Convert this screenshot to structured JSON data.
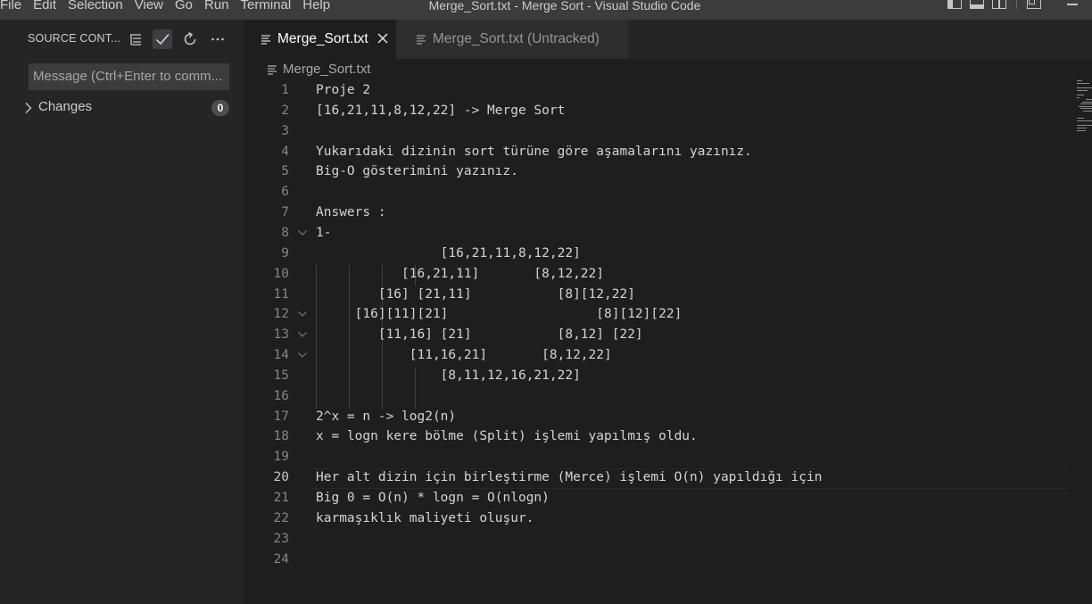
{
  "menu": [
    "File",
    "Edit",
    "Selection",
    "View",
    "Go",
    "Run",
    "Terminal",
    "Help"
  ],
  "window_title": "Merge_Sort.txt - Merge Sort - Visual Studio Code",
  "sidebar": {
    "title": "SOURCE CONT...",
    "commit_placeholder": "Message (Ctrl+Enter to comm...",
    "changes": {
      "label": "Changes",
      "count": "0"
    }
  },
  "tabs": [
    {
      "label": "Merge_Sort.txt",
      "active": true
    },
    {
      "label": "Merge_Sort.txt (Untracked)",
      "active": false
    }
  ],
  "breadcrumb": "Merge_Sort.txt",
  "current_line": 20,
  "lines": [
    {
      "n": "1",
      "text": "Proje 2"
    },
    {
      "n": "2",
      "text": "[16,21,11,8,12,22] -> Merge Sort"
    },
    {
      "n": "3",
      "text": ""
    },
    {
      "n": "4",
      "text": "Yukarıdaki dizinin sort türüne göre aşamalarını yazınız."
    },
    {
      "n": "5",
      "text": "Big-O gösterimini yazınız."
    },
    {
      "n": "6",
      "text": ""
    },
    {
      "n": "7",
      "text": "Answers :"
    },
    {
      "n": "8",
      "text": "1-"
    },
    {
      "n": "9",
      "text": "                [16,21,11,8,12,22]"
    },
    {
      "n": "10",
      "text": "           [16,21,11]       [8,12,22]"
    },
    {
      "n": "11",
      "text": "        [16] [21,11]           [8][12,22]"
    },
    {
      "n": "12",
      "text": "     [16][11][21]                   [8][12][22]"
    },
    {
      "n": "13",
      "text": "        [11,16] [21]           [8,12] [22]"
    },
    {
      "n": "14",
      "text": "            [11,16,21]       [8,12,22]"
    },
    {
      "n": "15",
      "text": "                [8,11,12,16,21,22]"
    },
    {
      "n": "16",
      "text": ""
    },
    {
      "n": "17",
      "text": "2^x = n -> log2(n)"
    },
    {
      "n": "18",
      "text": "x = logn kere bölme (Split) işlemi yapılmış oldu."
    },
    {
      "n": "19",
      "text": ""
    },
    {
      "n": "20",
      "text": "Her alt dizin için birleştirme (Merce) işlemi O(n) yapıldığı için"
    },
    {
      "n": "21",
      "text": "Big 0 = O(n) * logn = O(nlogn)"
    },
    {
      "n": "22",
      "text": "karmaşıklık maliyeti oluşur."
    },
    {
      "n": "23",
      "text": ""
    },
    {
      "n": "24",
      "text": ""
    }
  ],
  "folds": [
    "8",
    "12",
    "13",
    "14"
  ],
  "icons": {
    "tree_view": "list-tree-icon",
    "commit": "check-icon",
    "refresh": "refresh-icon",
    "more": "ellipsis-icon",
    "file": "text-file-icon",
    "close": "close-icon"
  },
  "colors": {
    "editor_bg": "#1e1e1e",
    "sidebar_bg": "#252526",
    "titlebar_bg": "#3c3c3c",
    "text": "#d4d4d4",
    "line_number": "#858585"
  }
}
